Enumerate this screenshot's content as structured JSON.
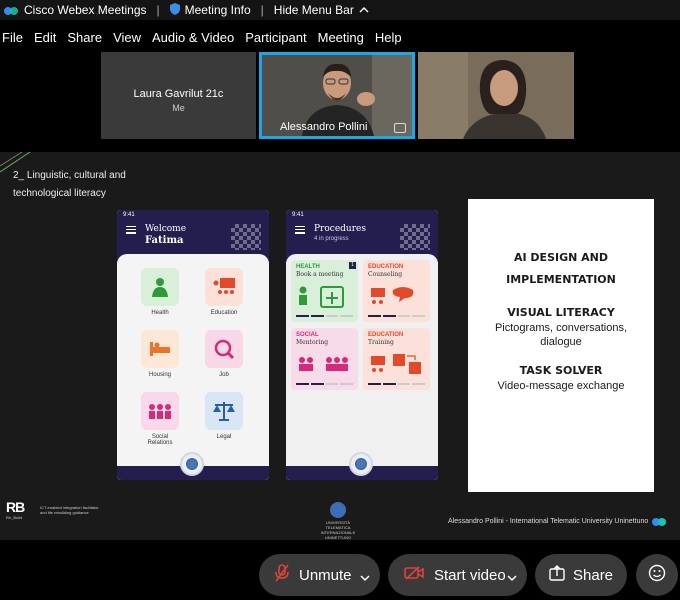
{
  "title_bar": {
    "app_name": "Cisco Webex Meetings",
    "meeting_info": "Meeting Info",
    "hide_menu_bar": "Hide Menu Bar",
    "sep1": "|",
    "sep2": "|"
  },
  "menu": {
    "items": [
      "File",
      "Edit",
      "Share",
      "View",
      "Audio & Video",
      "Participant",
      "Meeting",
      "Help"
    ]
  },
  "participants": {
    "laura": {
      "name": "Laura Gavrilut 21c",
      "me_label": "Me"
    },
    "alessandro": {
      "name": "Alessandro Pollini"
    }
  },
  "slide": {
    "heading_line1": "2_ Linguistic, cultural and",
    "heading_line2": "technological literacy",
    "phone1": {
      "time": "9:41",
      "greeting": "Welcome",
      "user": "Fatima",
      "categories": [
        {
          "label": "Health",
          "icon": "doctor-icon",
          "color": "#d8f0d8"
        },
        {
          "label": "Education",
          "icon": "classroom-icon",
          "color": "#fde0d8"
        },
        {
          "label": "Housing",
          "icon": "bed-icon",
          "color": "#fde8d8"
        },
        {
          "label": "Job",
          "icon": "job-icon",
          "color": "#f8d8e6"
        },
        {
          "label": "Social\nRelations",
          "icon": "people-icon",
          "color": "#f8d8ea"
        },
        {
          "label": "Legal",
          "icon": "scales-icon",
          "color": "#d8e6f5"
        }
      ]
    },
    "phone2": {
      "time": "9:41",
      "title": "Procedures",
      "subtitle": "4 in progress",
      "cards": [
        {
          "tag": "HEALTH",
          "title": "Book a meeting",
          "tag_color": "#2e9b3a",
          "bg": "#d9efd9",
          "progress": "2/4",
          "badge": "1"
        },
        {
          "tag": "EDUCATION",
          "title": "Counseling",
          "tag_color": "#e04a2a",
          "bg": "#fbe1da",
          "progress": "2/4"
        },
        {
          "tag": "SOCIAL",
          "title": "Mentoring",
          "tag_color": "#d42a7a",
          "bg": "#f8dbe9",
          "progress": "2/4"
        },
        {
          "tag": "EDUCATION",
          "title": "Training",
          "tag_color": "#e04a2a",
          "bg": "#fbe1da",
          "progress": "2/4"
        }
      ]
    },
    "panel": {
      "title_line1": "AI DESIGN AND",
      "title_line2": "IMPLEMENTATION",
      "visual_literacy": "VISUAL LITERACY",
      "visual_desc_line1": "Pictograms, conversations,",
      "visual_desc_line2": "dialogue",
      "task_solver": "TASK SOLVER",
      "task_desc": "Video-message exchange"
    },
    "footer": {
      "logo_mark": "RB",
      "logo_text": "Re_Build",
      "logo_small": "ICT-enabled integration facilitator and life rebuilding guidance",
      "uni_text": "UNIVERSITÀ TELEMATICA INTERNAZIONALE UNINETTUNO",
      "credit": "Alessandro Pollini - International Telematic University Uninettuno"
    }
  },
  "controls": {
    "mute": "Unmute",
    "video": "Start video",
    "share": "Share"
  },
  "colors": {
    "accent_blue": "#1ca8e8",
    "mute_red": "#e0423a",
    "phone_navy": "#231e4e"
  }
}
